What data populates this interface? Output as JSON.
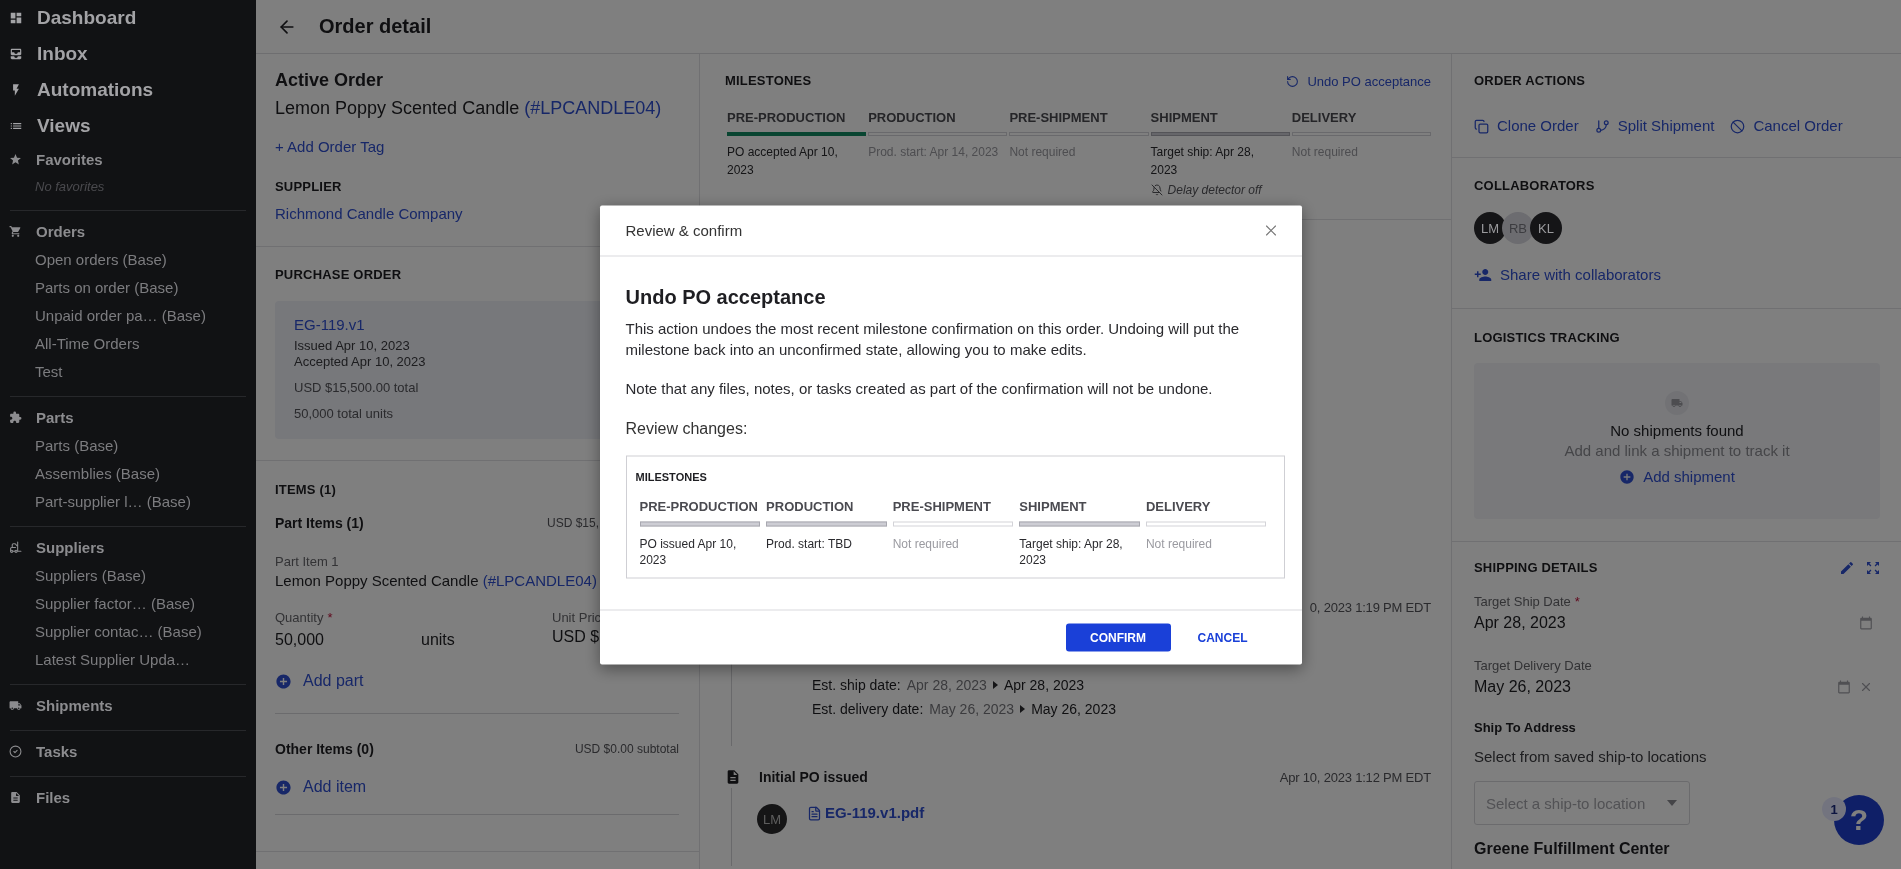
{
  "sidebar": {
    "top_items": [
      "Dashboard",
      "Inbox",
      "Automations",
      "Views"
    ],
    "favorites": {
      "title": "Favorites",
      "empty_text": "No favorites"
    },
    "groups": [
      {
        "title": "Orders",
        "items": [
          "Open orders (Base)",
          "Parts on order (Base)",
          "Unpaid order pa… (Base)",
          "All-Time Orders",
          "Test"
        ]
      },
      {
        "title": "Parts",
        "items": [
          "Parts (Base)",
          "Assemblies (Base)",
          "Part-supplier l… (Base)"
        ]
      },
      {
        "title": "Suppliers",
        "items": [
          "Suppliers (Base)",
          "Supplier factor… (Base)",
          "Supplier contac… (Base)",
          "Latest Supplier Upda…"
        ]
      },
      {
        "title": "Shipments"
      },
      {
        "title": "Tasks"
      },
      {
        "title": "Files"
      }
    ]
  },
  "header": {
    "title": "Order detail"
  },
  "order": {
    "heading": "Active Order",
    "name": "Lemon Poppy Scented Candle",
    "code": "(#LPCANDLE04)",
    "add_tag": "+ Add Order Tag",
    "supplier_label": "SUPPLIER",
    "supplier": "Richmond Candle Company"
  },
  "purchase_order": {
    "title": "PURCHASE ORDER",
    "doc": "EG-119.v1",
    "issued": "Issued Apr 10, 2023",
    "accepted": "Accepted Apr 10, 2023",
    "total": "USD $15,500.00 total",
    "units": "50,000 total units"
  },
  "items": {
    "title": "ITEMS (1)",
    "part_items": {
      "title": "Part Items (1)",
      "subtotal": "USD $15,",
      "item_label": "Part Item 1",
      "name": "Lemon Poppy Scented Candle",
      "code": "(#LPCANDLE04)",
      "quantity_label": "Quantity",
      "required_mark": "*",
      "quantity": "50,000",
      "unit": "units",
      "unit_price_label": "Unit Pric",
      "unit_price": "USD $",
      "add": "Add part"
    },
    "other_items": {
      "title": "Other Items (0)",
      "subtotal": "USD $0.00 subtotal",
      "add": "Add item"
    }
  },
  "milestones": {
    "title": "MILESTONES",
    "undo": "Undo PO acceptance",
    "stages": [
      {
        "label": "PRE-PRODUCTION",
        "confirmed": true,
        "planned": false,
        "note": "PO accepted Apr 10, 2023",
        "muted": false
      },
      {
        "label": "PRODUCTION",
        "confirmed": false,
        "planned": false,
        "note": "Prod. start: Apr 14, 2023",
        "muted": true
      },
      {
        "label": "PRE-SHIPMENT",
        "confirmed": false,
        "planned": false,
        "note": "Not required",
        "muted": true
      },
      {
        "label": "SHIPMENT",
        "confirmed": false,
        "planned": true,
        "note": "Target ship: Apr 28, 2023",
        "muted": false,
        "alert": "Delay detector off"
      },
      {
        "label": "DELIVERY",
        "confirmed": false,
        "planned": false,
        "note": "Not required",
        "muted": true
      }
    ]
  },
  "timeline": [
    {
      "time": "0, 2023 1:19 PM EDT",
      "changes": [
        {
          "label": "Est. ship date:",
          "from": "Apr 28, 2023",
          "to": "Apr 28, 2023"
        },
        {
          "label": "Est. delivery date:",
          "from": "May 26, 2023",
          "to": "May 26, 2023"
        }
      ]
    },
    {
      "title": "Initial PO issued",
      "time": "Apr 10, 2023 1:12 PM EDT",
      "avatar": "LM",
      "file": "EG-119.v1.pdf"
    }
  ],
  "order_actions": {
    "title": "ORDER ACTIONS",
    "actions": [
      "Clone Order",
      "Split Shipment",
      "Cancel Order"
    ]
  },
  "collaborators": {
    "title": "COLLABORATORS",
    "people": [
      {
        "initials": "LM",
        "color": "#151517"
      },
      {
        "initials": "RB",
        "color": "#6c6c70"
      },
      {
        "initials": "KL",
        "color": "#151517"
      }
    ],
    "share": "Share with collaborators"
  },
  "logistics": {
    "title": "LOGISTICS TRACKING",
    "empty_title": "No shipments found",
    "empty_hint": "Add and link a shipment to track it",
    "add": "Add shipment"
  },
  "shipping": {
    "title": "SHIPPING DETAILS",
    "fields": [
      {
        "label": "Target Ship Date",
        "required_mark": "*",
        "value": "Apr 28, 2023",
        "clearable": false
      },
      {
        "label": "Target Delivery Date",
        "value": "May 26, 2023",
        "clearable": true
      }
    ],
    "address_label": "Ship To Address",
    "address_hint": "Select from saved ship-to locations",
    "select_placeholder": "Select a ship-to location",
    "location": "Greene Fulfillment Center"
  },
  "help": {
    "badge": "1",
    "label": "?"
  },
  "modal": {
    "title": "Review & confirm",
    "heading": "Undo PO acceptance",
    "body": "This action undoes the most recent milestone confirmation on this order. Undoing will put the milestone back into an unconfirmed state, allowing you to make edits.",
    "note": "Note that any files, notes, or tasks created as part of the confirmation will not be undone.",
    "review_label": "Review changes:",
    "preview": {
      "title": "MILESTONES",
      "stages": [
        {
          "label": "PRE-PRODUCTION",
          "confirmed": false,
          "planned": true,
          "note": "PO issued Apr 10, 2023",
          "muted": false
        },
        {
          "label": "PRODUCTION",
          "confirmed": false,
          "planned": true,
          "note": "Prod. start: TBD",
          "muted": false
        },
        {
          "label": "PRE-SHIPMENT",
          "confirmed": false,
          "planned": false,
          "note": "Not required",
          "muted": true
        },
        {
          "label": "SHIPMENT",
          "confirmed": false,
          "planned": true,
          "note": "Target ship: Apr 28, 2023",
          "muted": false
        },
        {
          "label": "DELIVERY",
          "confirmed": false,
          "planned": false,
          "note": "Not required",
          "muted": true
        }
      ]
    },
    "confirm": "CONFIRM",
    "cancel": "CANCEL"
  }
}
